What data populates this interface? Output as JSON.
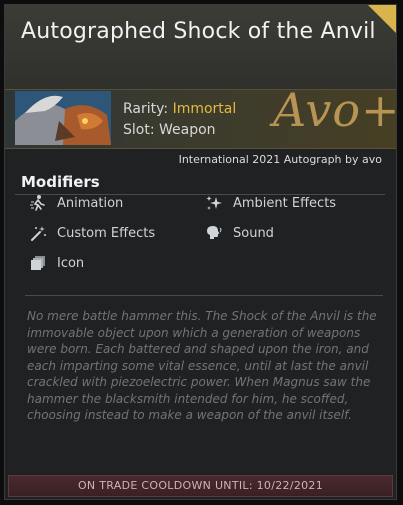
{
  "item": {
    "title": "Autographed Shock of the Anvil",
    "rarity_label": "Rarity: ",
    "rarity_value": "Immortal",
    "slot": "Slot: Weapon",
    "signature": "Avo+",
    "autograph_line": "International 2021 Autograph by avo"
  },
  "modifiers": {
    "heading": "Modifiers",
    "items": [
      {
        "label": "Animation",
        "icon": "running-figure-icon"
      },
      {
        "label": "Ambient Effects",
        "icon": "sparkles-icon"
      },
      {
        "label": "Custom Effects",
        "icon": "magic-wand-icon"
      },
      {
        "label": "Sound",
        "icon": "speaker-head-icon"
      },
      {
        "label": "Icon",
        "icon": "stacked-squares-icon"
      }
    ]
  },
  "description": "No mere battle hammer this. The Shock of the Anvil is the immovable object upon which a generation of weapons were born. Each battered and shaped upon the iron, and each imparting some vital essence, until at last the anvil crackled with piezoelectric power. When Magnus saw the hammer the blacksmith intended for him, he scoffed, choosing instead to make a weapon of the anvil itself.",
  "cooldown": "ON TRADE COOLDOWN UNTIL: 10/22/2021",
  "colors": {
    "rarity_immortal": "#e4b93f",
    "corner_accent": "#d9b44a",
    "signature_ink": "#b89454",
    "cooldown_bg": "#4a2a2e"
  }
}
